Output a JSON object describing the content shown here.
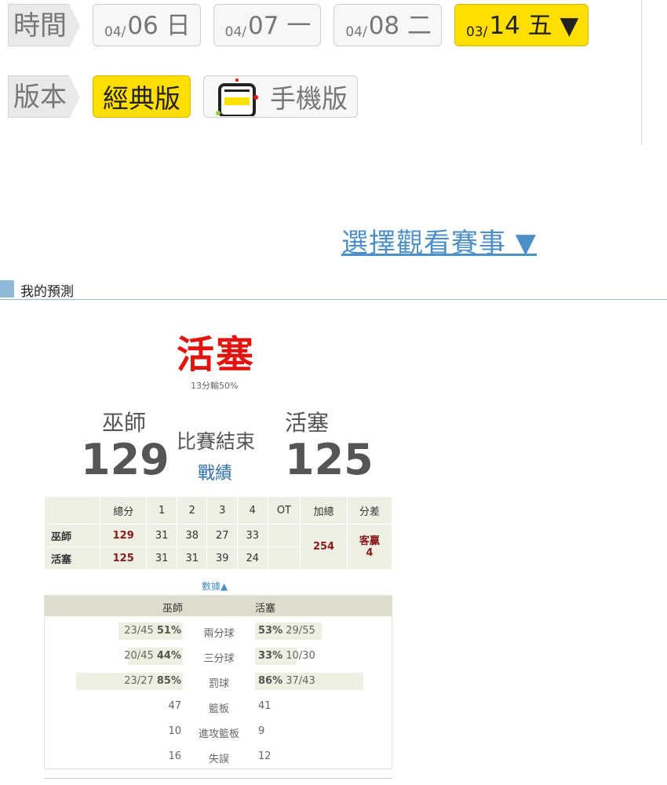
{
  "time_row": {
    "label": "時間",
    "dates": [
      {
        "md": "04/",
        "day": "06 日"
      },
      {
        "md": "04/",
        "day": "07 一"
      },
      {
        "md": "04/",
        "day": "08 二"
      },
      {
        "md": "03/",
        "day": "14 五 ▼"
      }
    ]
  },
  "version_row": {
    "label": "版本",
    "classic": "經典版",
    "mobile": "手機版"
  },
  "select_game": "選擇觀看賽事 ▼",
  "section_title": "我的預測",
  "prediction": {
    "winner": "活塞",
    "note": "13分輸50%"
  },
  "game": {
    "away_name": "巫師",
    "away_score": "129",
    "home_name": "活塞",
    "home_score": "125",
    "status": "比賽結束",
    "record_link": "戰績"
  },
  "box_score": {
    "headers": [
      "",
      "總分",
      "1",
      "2",
      "3",
      "4",
      "OT",
      "加總",
      "分差"
    ],
    "away": {
      "team": "巫師",
      "total": "129",
      "q": [
        "31",
        "38",
        "27",
        "33"
      ],
      "ot": ""
    },
    "home": {
      "team": "活塞",
      "total": "125",
      "q": [
        "31",
        "31",
        "39",
        "24"
      ],
      "ot": ""
    },
    "sum": "254",
    "diff_line1": "客贏",
    "diff_line2": "4"
  },
  "stats": {
    "toggle": "數據▲",
    "away_team": "巫師",
    "home_team": "活塞",
    "rows": [
      {
        "label": "兩分球",
        "away_raw": "23/45",
        "away_pct": "51%",
        "home_pct": "53%",
        "home_raw": "29/55",
        "away_frac": 0.51,
        "home_frac": 0.53
      },
      {
        "label": "三分球",
        "away_raw": "20/45",
        "away_pct": "44%",
        "home_pct": "33%",
        "home_raw": "10/30",
        "away_frac": 0.44,
        "home_frac": 0.33
      },
      {
        "label": "罰球",
        "away_raw": "23/27",
        "away_pct": "85%",
        "home_pct": "86%",
        "home_raw": "37/43",
        "away_frac": 0.85,
        "home_frac": 0.86
      },
      {
        "label": "籃板",
        "away_val": "47",
        "home_val": "41"
      },
      {
        "label": "進攻籃板",
        "away_val": "10",
        "home_val": "9"
      },
      {
        "label": "失誤",
        "away_val": "16",
        "home_val": "12"
      }
    ]
  }
}
